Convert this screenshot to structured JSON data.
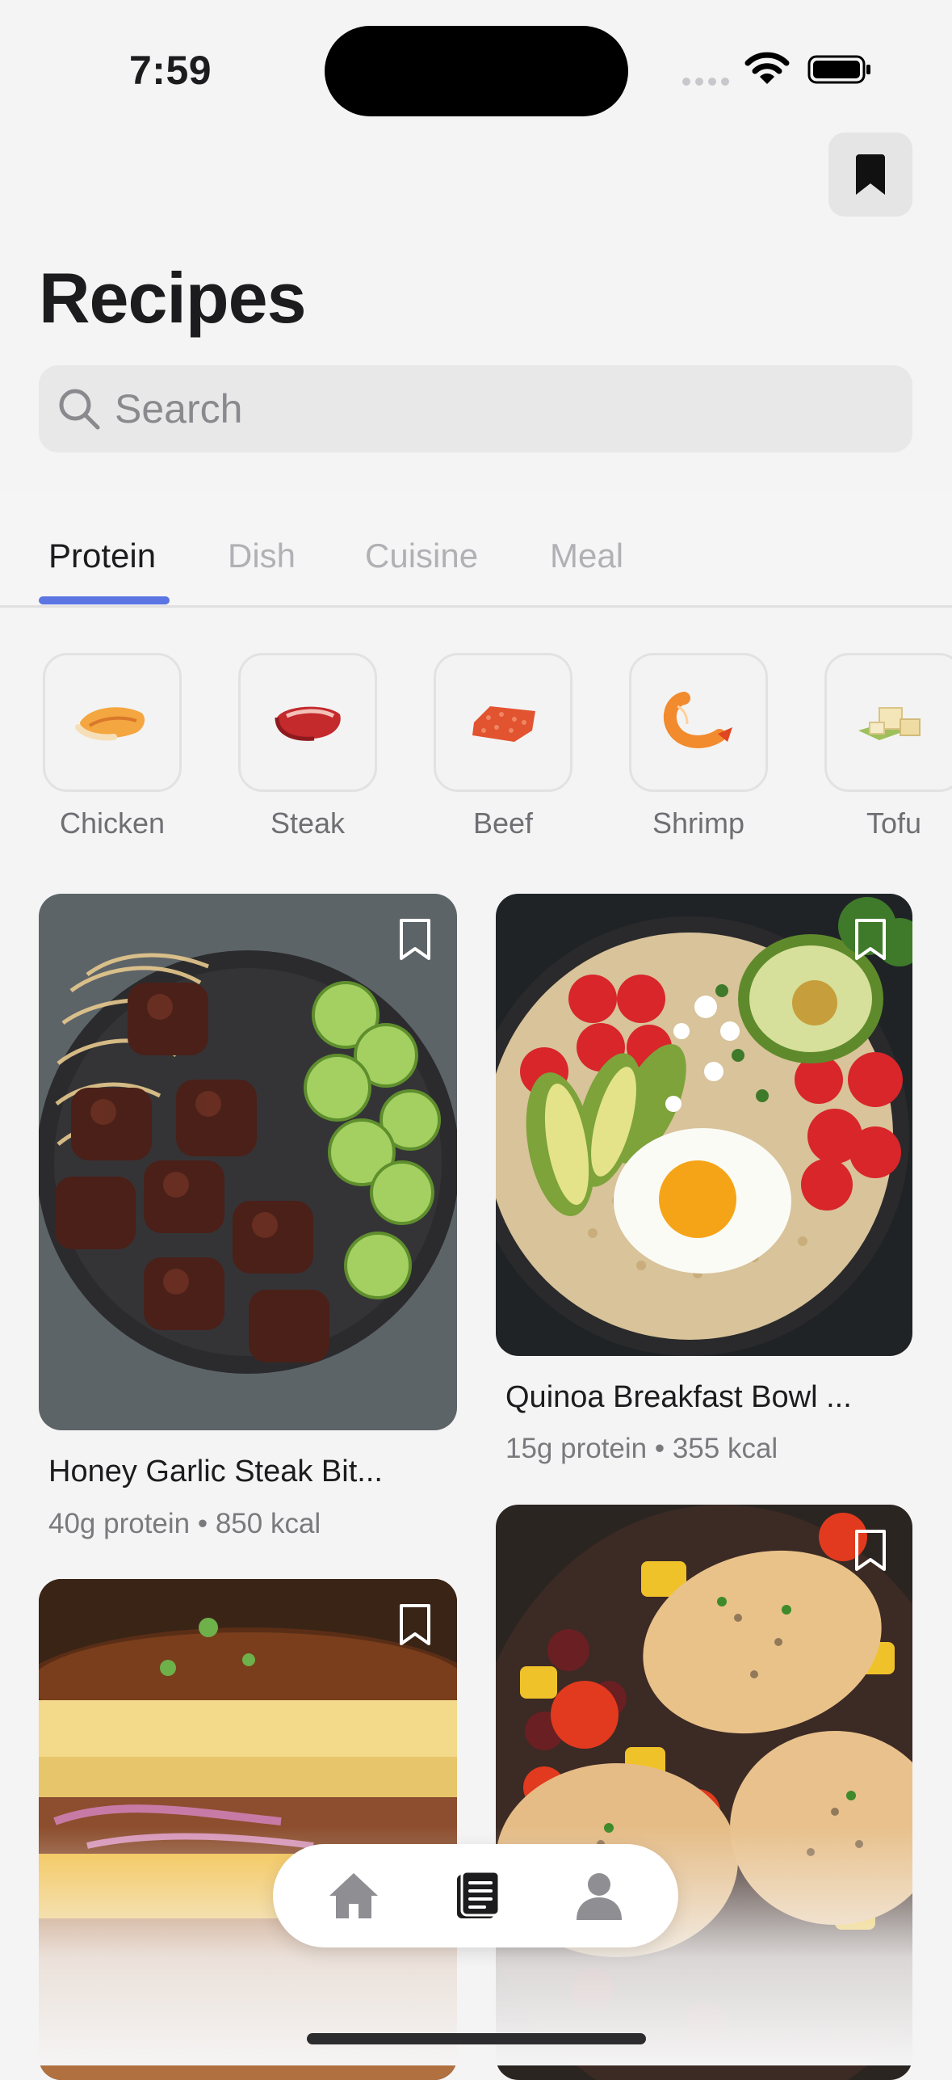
{
  "status_bar": {
    "time": "7:59"
  },
  "header": {
    "title": "Recipes",
    "bookmark_icon": "bookmark-icon"
  },
  "search": {
    "placeholder": "Search",
    "value": ""
  },
  "tabs": [
    {
      "label": "Protein",
      "active": true
    },
    {
      "label": "Dish",
      "active": false
    },
    {
      "label": "Cuisine",
      "active": false
    },
    {
      "label": "Meal",
      "active": false
    }
  ],
  "categories": [
    {
      "label": "Chicken",
      "icon": "chicken-icon"
    },
    {
      "label": "Steak",
      "icon": "steak-icon"
    },
    {
      "label": "Beef",
      "icon": "ground-beef-icon"
    },
    {
      "label": "Shrimp",
      "icon": "shrimp-icon"
    },
    {
      "label": "Tofu",
      "icon": "tofu-icon"
    }
  ],
  "recipes": [
    {
      "title": "Honey Garlic Steak Bit...",
      "meta": "40g protein • 850 kcal"
    },
    {
      "title": "Quinoa Breakfast Bowl ...",
      "meta": "15g protein • 355 kcal"
    },
    {
      "title": "",
      "meta": ""
    },
    {
      "title": "",
      "meta": ""
    }
  ],
  "tab_bar": {
    "items": [
      {
        "icon": "home-icon",
        "active": false
      },
      {
        "icon": "recipes-icon",
        "active": true
      },
      {
        "icon": "profile-icon",
        "active": false
      }
    ]
  },
  "colors": {
    "accent": "#5b75e3",
    "background": "#f5f4f4"
  }
}
